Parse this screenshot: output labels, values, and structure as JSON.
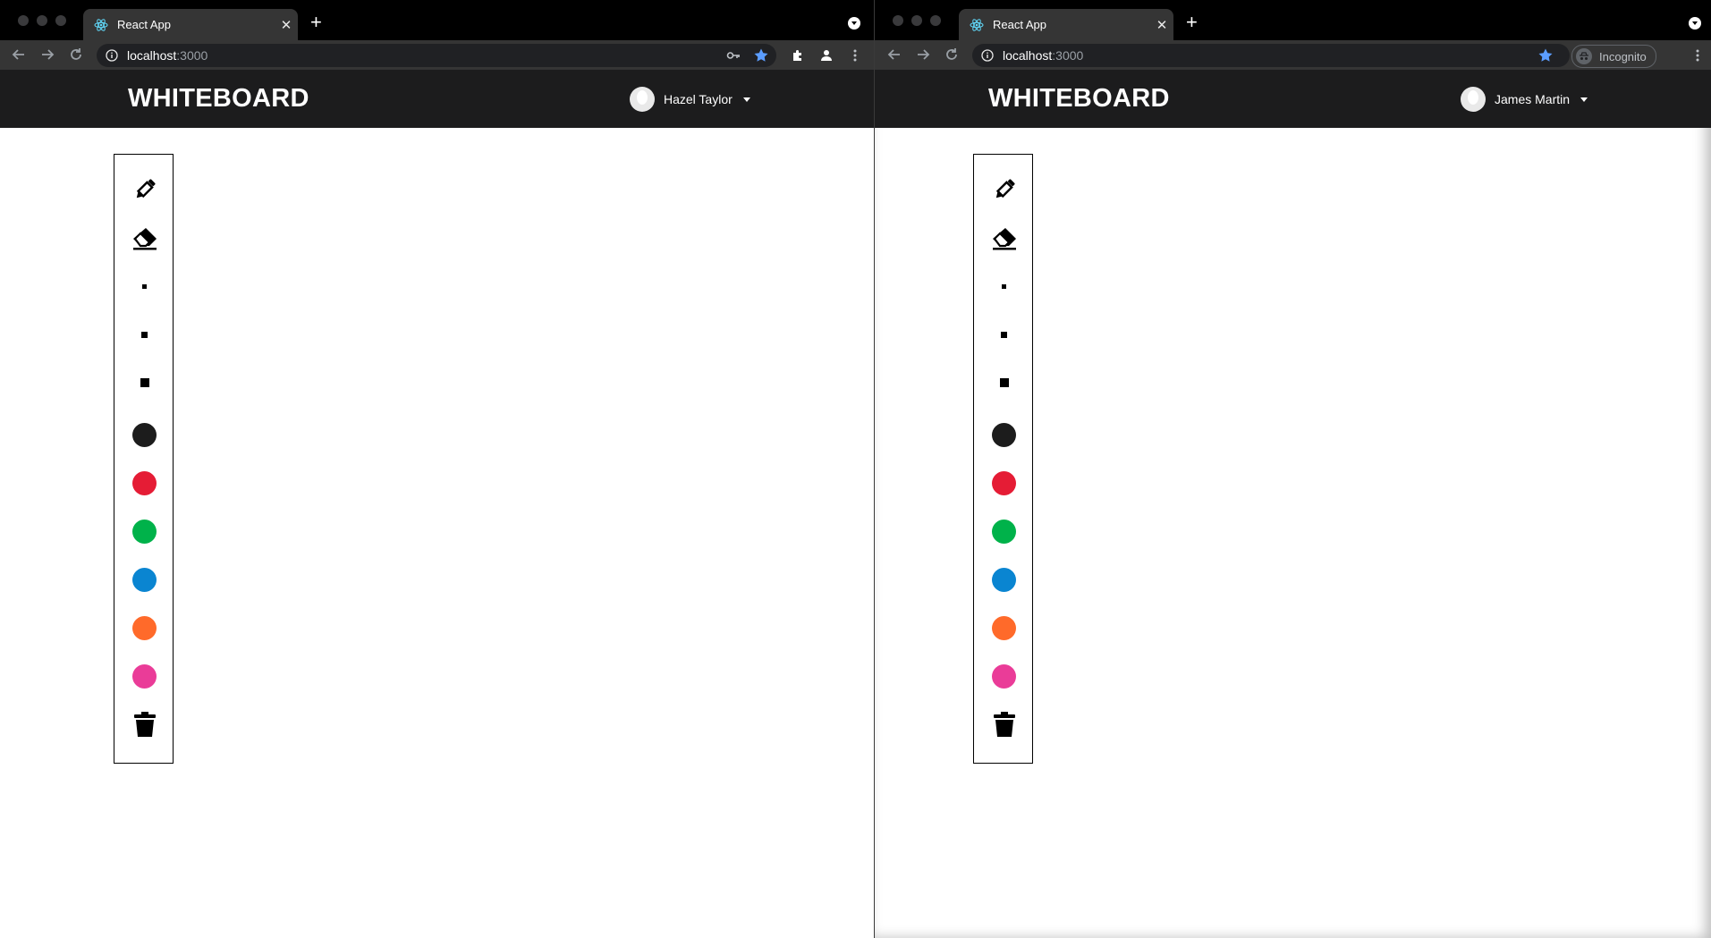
{
  "windows": [
    {
      "tab_title": "React App",
      "url_host": "localhost",
      "url_port": ":3000",
      "app_title": "WHITEBOARD",
      "user_name": "Hazel Taylor"
    },
    {
      "tab_title": "React App",
      "url_host": "localhost",
      "url_port": ":3000",
      "app_title": "WHITEBOARD",
      "user_name": "James Martin",
      "incognito_label": "Incognito"
    }
  ],
  "toolbar": {
    "tools": [
      "pencil-icon",
      "eraser-icon"
    ],
    "brush_sizes": [
      "small",
      "medium",
      "large"
    ],
    "colors": [
      {
        "name": "black",
        "hex": "#1c1c1c"
      },
      {
        "name": "red",
        "hex": "#e51c35"
      },
      {
        "name": "green",
        "hex": "#00b24a"
      },
      {
        "name": "blue",
        "hex": "#0a85d1"
      },
      {
        "name": "orange",
        "hex": "#ff6a2a"
      },
      {
        "name": "pink",
        "hex": "#ea3c98"
      }
    ],
    "clear_icon": "trash-icon"
  },
  "theme": {
    "header_bg": "#1c1c1d",
    "browser_tab_bg": "#353535",
    "star_color": "#5b9dff"
  }
}
